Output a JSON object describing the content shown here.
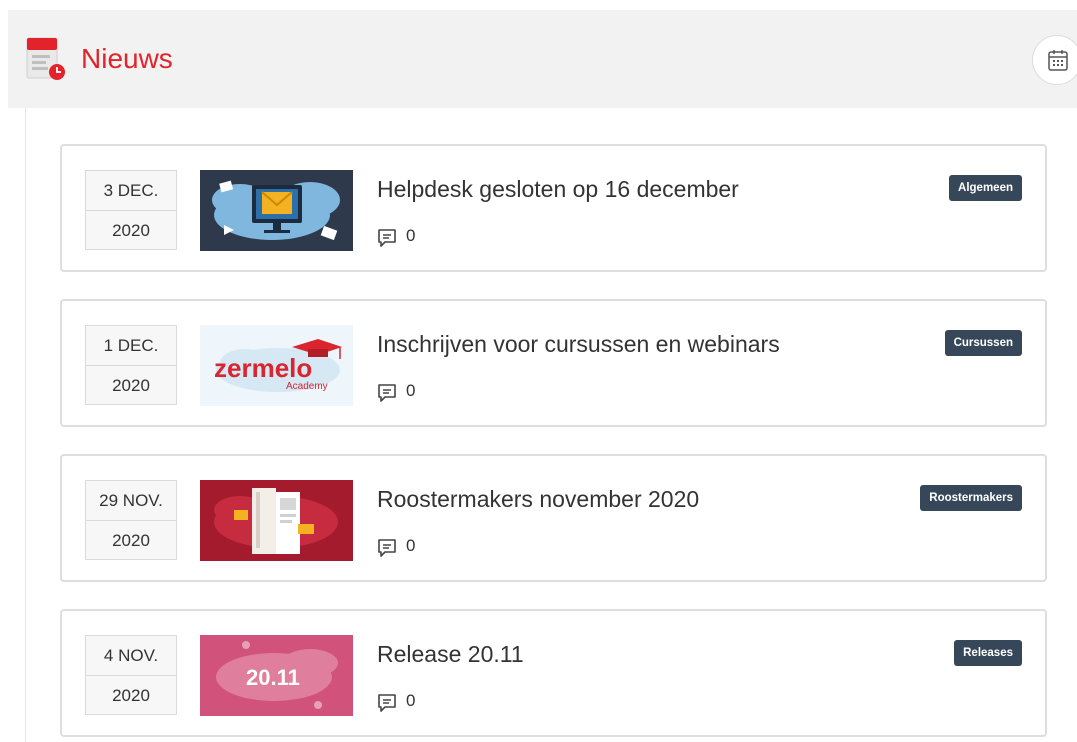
{
  "header": {
    "title": "Nieuws",
    "title_icon": "news-document-icon",
    "calendar_button_icon": "calendar-icon"
  },
  "colors": {
    "brand_red": "#e3232c",
    "tag_background": "#36475a"
  },
  "news": [
    {
      "day": "3 DEC.",
      "year": "2020",
      "title": "Helpdesk gesloten op 16 december",
      "comments": "0",
      "tag": "Algemeen",
      "thumbnail": "email-envelope-monitor-illustration"
    },
    {
      "day": "1 DEC.",
      "year": "2020",
      "title": "Inschrijven voor cursussen en webinars",
      "comments": "0",
      "tag": "Cursussen",
      "thumbnail": "zermelo-academy-logo",
      "thumbnail_text": "zermelo",
      "thumbnail_subtext": "Academy"
    },
    {
      "day": "29 NOV.",
      "year": "2020",
      "title": "Roostermakers november 2020",
      "comments": "0",
      "tag": "Roostermakers",
      "thumbnail": "newsletter-pages-illustration"
    },
    {
      "day": "4 NOV.",
      "year": "2020",
      "title": "Release 20.11",
      "comments": "0",
      "tag": "Releases",
      "thumbnail": "release-badge-illustration",
      "thumbnail_text": "20.11"
    }
  ]
}
